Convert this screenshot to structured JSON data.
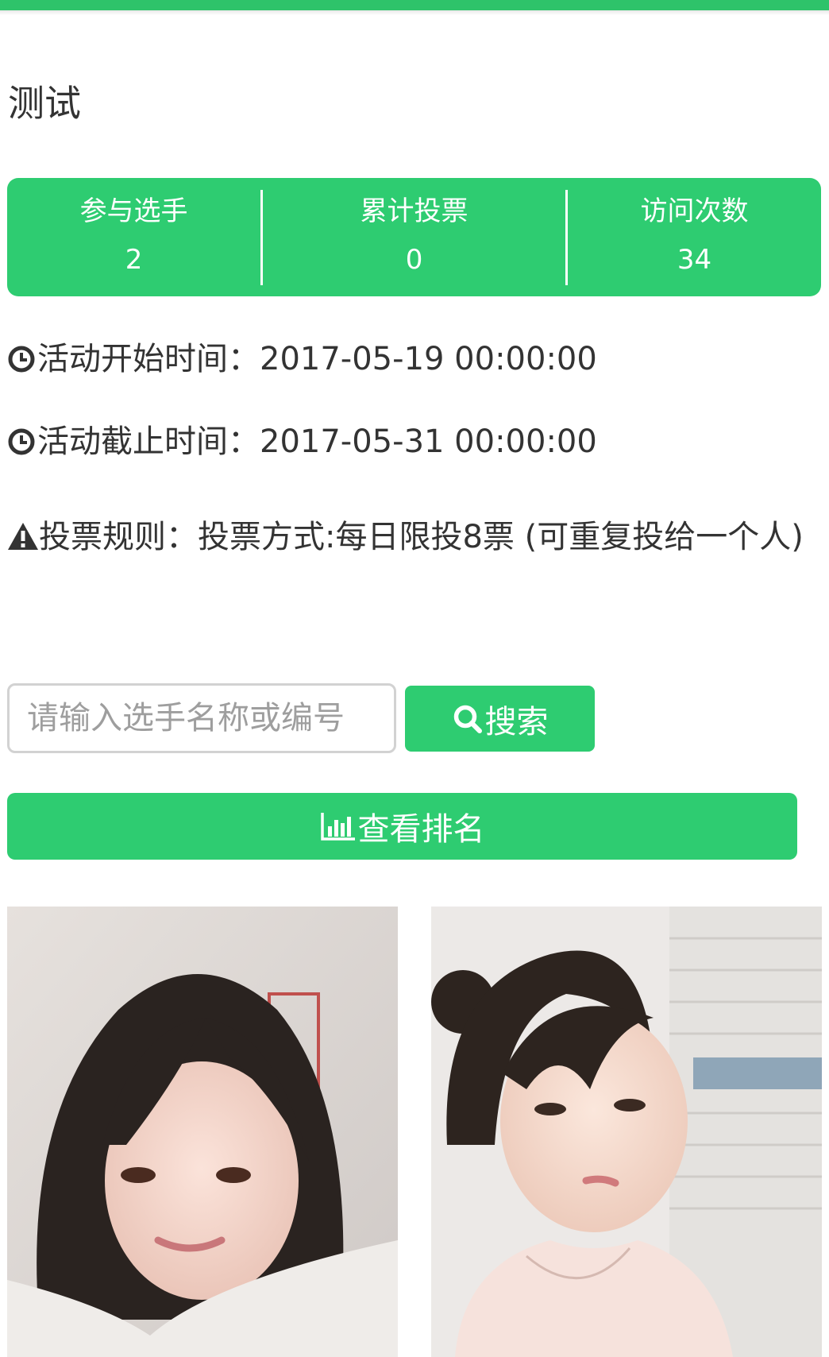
{
  "page": {
    "title": "测试",
    "accent_color": "#2ecc71"
  },
  "stats": [
    {
      "label": "参与选手",
      "value": "2"
    },
    {
      "label": "累计投票",
      "value": "0"
    },
    {
      "label": "访问次数",
      "value": "34"
    }
  ],
  "info": {
    "start_label": "活动开始时间：",
    "start_value": "2017-05-19 00:00:00",
    "end_label": "活动截止时间：",
    "end_value": "2017-05-31 00:00:00",
    "rule_label": "投票规则：",
    "rule_value": "投票方式:每日限投8票 (可重复投给一个人)",
    "start_icon": "clock-icon",
    "end_icon": "clock-icon",
    "rule_icon": "warning-icon"
  },
  "search": {
    "placeholder": "请输入选手名称或编号",
    "value": "",
    "button_label": "搜索",
    "button_icon": "search-icon"
  },
  "ranking": {
    "button_label": "查看排名",
    "button_icon": "bar-chart-icon"
  },
  "contestants": [
    {
      "photo": "contestant-photo-1"
    },
    {
      "photo": "contestant-photo-2"
    }
  ]
}
